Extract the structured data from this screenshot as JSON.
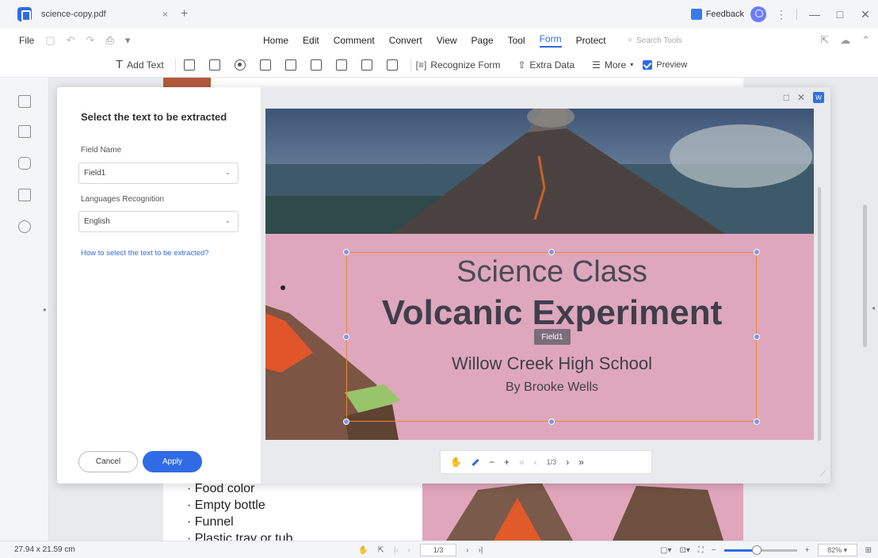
{
  "window": {
    "tab_name": "science-copy.pdf",
    "tab_close": "×",
    "new_tab": "+",
    "feedback": "Feedback",
    "kebab": "⋮",
    "minimize": "—",
    "maximize": "□",
    "close": "✕"
  },
  "menubar": {
    "file": "File",
    "items": [
      "Home",
      "Edit",
      "Comment",
      "Convert",
      "View",
      "Page",
      "Tool",
      "Form",
      "Protect"
    ],
    "active": "Form",
    "search_placeholder": "Search Tools"
  },
  "toolbar": {
    "add_text": "Add Text",
    "recognize_form": "Recognize Form",
    "extra_data": "Extra Data",
    "more": "More",
    "preview": "Preview"
  },
  "dialog": {
    "title": "Select the text to be extracted",
    "field_name_label": "Field Name",
    "field_name_value": "Field1",
    "language_label": "Languages Recognition",
    "language_value": "English",
    "help_link": "How to select the text to be extracted?",
    "cancel": "Cancel",
    "apply": "Apply",
    "selection_tag": "Field1",
    "page_indicator": "1/3"
  },
  "preview_page": {
    "title_line": "Science Class",
    "main_line": "Volcanic Experiment",
    "school": "Willow Creek High School",
    "author": "By Brooke Wells"
  },
  "document": {
    "bullets": [
      "Food color",
      "Empty bottle",
      "Funnel",
      "Plastic tray or tub"
    ]
  },
  "status": {
    "page_size": "27.94 x 21.59 cm",
    "page_indicator": "1/3",
    "zoom": "82%",
    "zoom_fraction": 0.45
  },
  "colors": {
    "accent": "#2f6be5",
    "selection_border": "#e48a38",
    "pink_background": "#dea7bd"
  }
}
